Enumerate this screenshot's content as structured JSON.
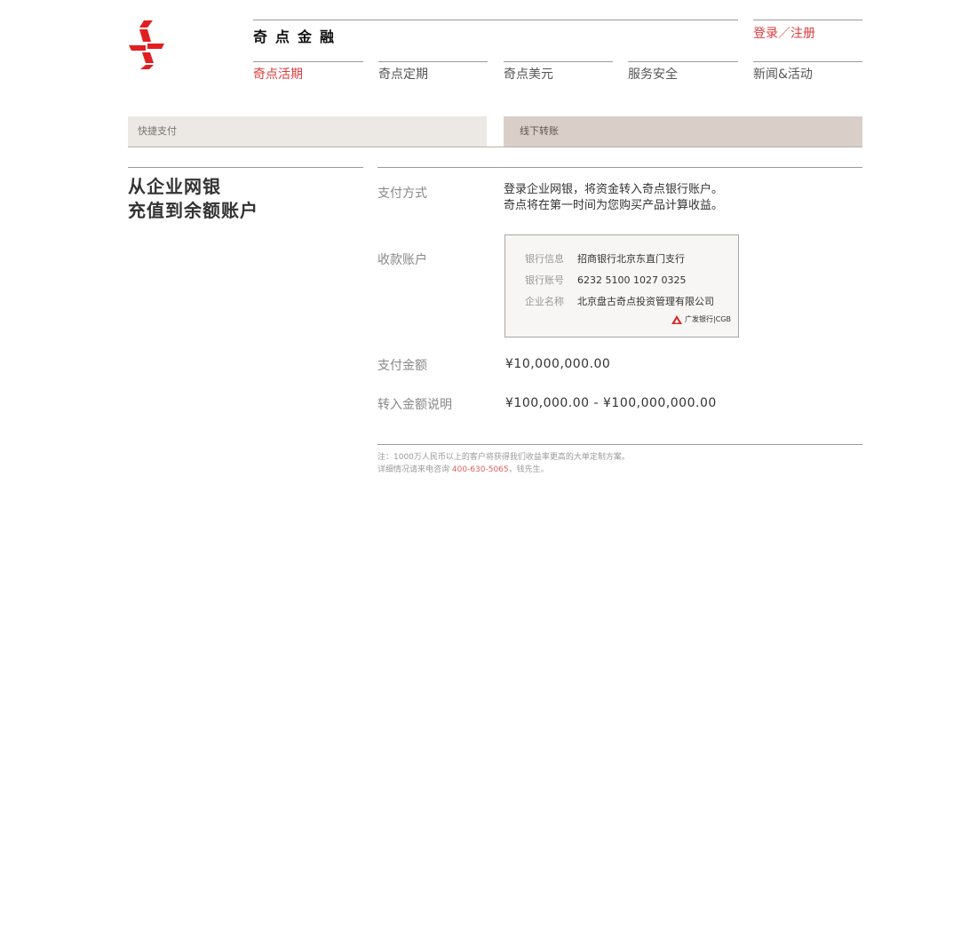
{
  "header": {
    "brand": "奇点金融",
    "login_register": "登录／注册",
    "nav": [
      {
        "label": "奇点活期",
        "active": true
      },
      {
        "label": "奇点定期",
        "active": false
      },
      {
        "label": "奇点美元",
        "active": false
      },
      {
        "label": "服务安全",
        "active": false
      },
      {
        "label": "新闻&活动",
        "active": false
      }
    ]
  },
  "tabs": [
    {
      "label": "快捷支付",
      "active": false
    },
    {
      "label": "线下转账",
      "active": true
    }
  ],
  "left_title": {
    "line1": "从企业网银",
    "line2": "充值到余额账户"
  },
  "details": {
    "payment_method": {
      "label": "支付方式",
      "line1": "登录企业网银，将资金转入奇点银行账户。",
      "line2": "奇点将在第一时间为您购买产品计算收益。"
    },
    "receiving_account": {
      "label": "收款账户",
      "bank_info_key": "银行信息",
      "bank_info_value": "招商银行北京东直门支行",
      "account_no_key": "银行账号",
      "account_no_value": "6232 5100 1027 0325",
      "company_key": "企业名称",
      "company_value": "北京盘古奇点投资管理有限公司",
      "bank_logo_text": "广发银行|CGB"
    },
    "payment_amount": {
      "label": "支付金额",
      "value": "¥10,000,000.00"
    },
    "transfer_range": {
      "label": "转入金额说明",
      "value": "¥100,000.00 - ¥100,000,000.00"
    }
  },
  "note": {
    "line1": "注：1000万人民币以上的客户将获得我们收益率更高的大单定制方案。",
    "line2_prefix": "详细情况请来电咨询 ",
    "phone": "400-630-5065",
    "line2_suffix": "，钱先生。"
  },
  "colors": {
    "accent": "#e03b3b",
    "tab_inactive_bg": "#ece8e4",
    "tab_active_bg": "#d9cfc8"
  }
}
